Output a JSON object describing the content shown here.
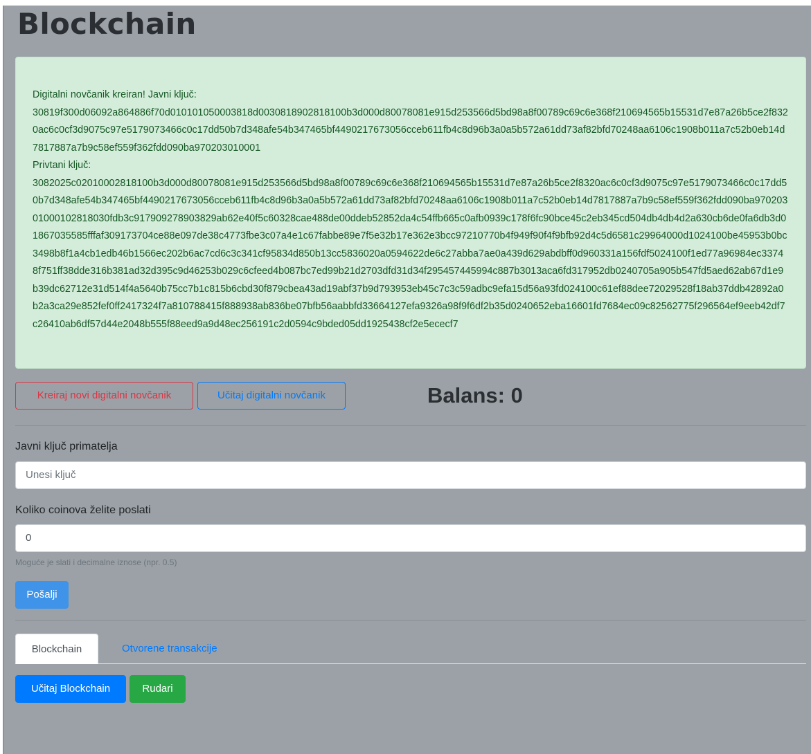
{
  "page": {
    "title": "Blockchain"
  },
  "wallet_alert": {
    "line1": "Digitalni novčanik kreiran! Javni ključ:",
    "public_key": "30819f300d06092a864886f70d010101050003818d0030818902818100b3d000d80078081e915d253566d5bd98a8f00789c69c6e368f210694565b15531d7e87a26b5ce2f8320ac6c0cf3d9075c97e5179073466c0c17dd50b7d348afe54b347465bf4490217673056cceb611fb4c8d96b3a0a5b572a61dd73af82bfd70248aa6106c1908b011a7c52b0eb14d7817887a7b9c58ef559f362fdd090ba970203010001",
    "private_label": "Privtani ključ:",
    "private_key": "3082025c02010002818100b3d000d80078081e915d253566d5bd98a8f00789c69c6e368f210694565b15531d7e87a26b5ce2f8320ac6c0cf3d9075c97e5179073466c0c17dd50b7d348afe54b347465bf4490217673056cceb611fb4c8d96b3a0a5b572a61dd73af82bfd70248aa6106c1908b011a7c52b0eb14d7817887a7b9c58ef559f362fdd090ba97020301000102818030fdb3c917909278903829ab62e40f5c60328cae488de00ddeb52852da4c54ffb665c0afb0939c178f6fc90bce45c2eb345cd504db4db4d2a630cb6de0fa6db3d01867035585fffaf309173704ce88e097de38c4773fbe3c07a4e1c67fabbe89e7f5e32b17e362e3bcc97210770b4f949f90f4f9bfb92d4c5d6581c29964000d1024100be45953b0bc3498b8f1a4cb1edb46b1566ec202b6ac7cd6c3c341cf95834d850b13cc5836020a0594622de6c27abba7ae0a439d629abdbff0d960331a156fdf5024100f1ed77a96984ec33748f751ff38dde316b381ad32d395c9d46253b029c6cfeed4b087bc7ed99b21d2703dfd31d34f295457445994c887b3013aca6fd317952db0240705a905b547fd5aed62ab67d1e9b39dc62712e31d514f4a5640b75cc7b1c815b6cbd30f879cbea43ad19abf37b9d793953eb45c7c3c59adbc9efa15d56a93fd024100c61ef88dee72029528f18ab37ddb42892a0b2a3ca29e852fef0ff2417324f7a810788415f888938ab836be07bfb56aabbfd33664127efa9326a98f9f6df2b35d0240652eba16601fd7684ec09c82562775f296564ef9eeb42df7c26410ab6df57d44e2048b555f88eed9a9d48ec256191c2d0594c9bded05dd1925438cf2e5ececf7"
  },
  "actions": {
    "create_wallet_label": "Kreiraj novi digitalni novčanik",
    "load_wallet_label": "Učitaj digitalni novčanik",
    "balance_text": "Balans: 0"
  },
  "form": {
    "recipient_label": "Javni ključ primatelja",
    "recipient_placeholder": "Unesi ključ",
    "amount_label": "Koliko coinova želite poslati",
    "amount_value": "0",
    "amount_help": "Moguće je slati i decimalne iznose (npr. 0.5)",
    "send_label": "Pošalji"
  },
  "tabs": [
    {
      "label": "Blockchain",
      "active": true
    },
    {
      "label": "Otvorene transakcije",
      "active": false
    }
  ],
  "chain_actions": {
    "load_chain_label": "Učitaj Blockchain",
    "mine_label": "Rudari"
  },
  "colors": {
    "page_bg": "#9ba1a6",
    "alert_bg": "#d4edda",
    "alert_text": "#155724",
    "danger": "#dc3545",
    "primary": "#007bff",
    "success": "#28a745"
  }
}
